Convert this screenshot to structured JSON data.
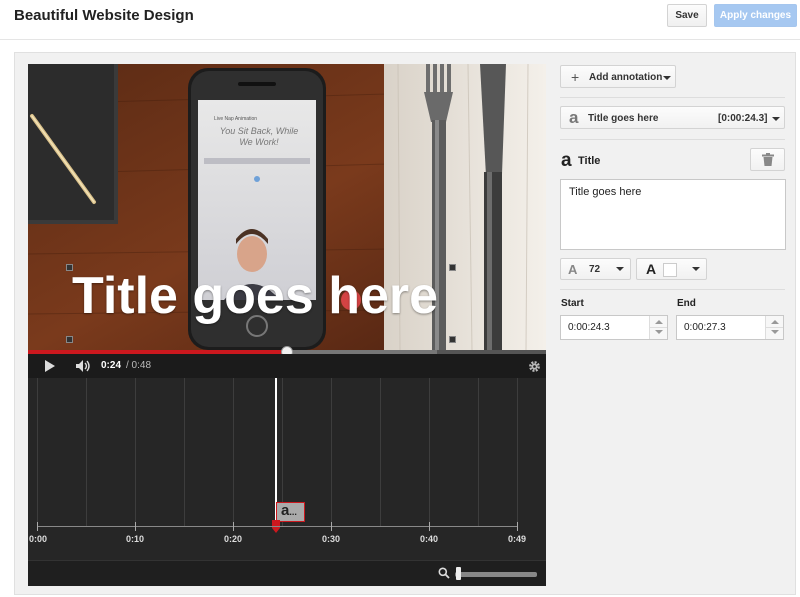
{
  "header": {
    "title": "Beautiful Website Design",
    "save_label": "Save",
    "apply_label": "Apply changes"
  },
  "player": {
    "overlay_text": "Title goes here",
    "phone_small_text": "Live Nap Animation",
    "phone_tagline": "You Sit Back, While We Work!",
    "current_time": "0:24",
    "total_time": "/ 0:48",
    "progress_fraction": 0.5,
    "buffered_fraction": 0.79,
    "accent_color": "#cc181e",
    "icons": [
      "play-icon",
      "volume-icon",
      "settings-gear-icon"
    ]
  },
  "timeline": {
    "ticks": [
      "0:00",
      "0:10",
      "0:20",
      "0:30",
      "0:40",
      "0:49"
    ],
    "annotation_chip": "a",
    "annotation_chip_suffix": "...",
    "playhead_fraction": 0.49,
    "zoom_level": 0.0
  },
  "editor": {
    "add_annotation_label": "Add annotation",
    "selected_annotation": {
      "icon": "a",
      "label": "Title goes here",
      "time": "[0:00:24.3]"
    },
    "section_icon": "a",
    "section_title": "Title",
    "text_value": "Title goes here",
    "font_size": "72",
    "font_color_icon": "A",
    "font_color": "#ffffff",
    "start_label": "Start",
    "start_value": "0:00:24.3",
    "end_label": "End",
    "end_value": "0:00:27.3"
  }
}
